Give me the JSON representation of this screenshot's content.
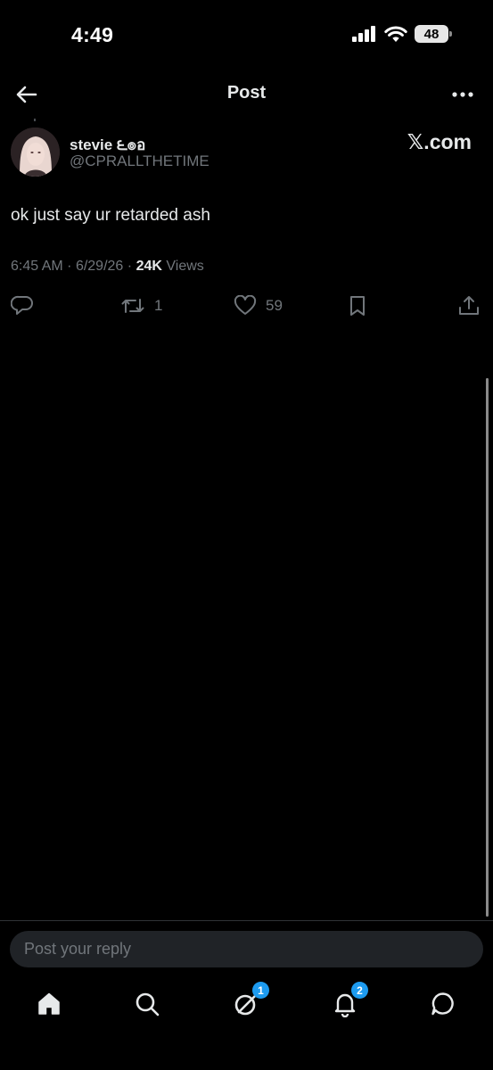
{
  "status_bar": {
    "time": "4:49",
    "battery": "48"
  },
  "header": {
    "title": "Post"
  },
  "post": {
    "author": {
      "name": "stevie ౬๏อ",
      "handle": "@CPRALLTHETIME"
    },
    "source": "𝕏.com",
    "text": "ok just say ur retarded ash",
    "meta": {
      "time": "6:45 AM",
      "date": "6/29/26",
      "views_count": "24K",
      "views_label": "Views"
    },
    "actions": {
      "reposts": "1",
      "likes": "59"
    }
  },
  "reply": {
    "placeholder": "Post your reply"
  },
  "tabs": {
    "messages_badge": "1",
    "notifications_badge": "2"
  },
  "colors": {
    "background": "#000000",
    "text": "#e7e9ea",
    "muted": "#71767b",
    "accent": "#1d9bf0",
    "input_bg": "#202327"
  },
  "icons": [
    "back-arrow-icon",
    "more-icon",
    "reply-icon",
    "repost-icon",
    "like-icon",
    "bookmark-icon",
    "share-icon",
    "home-icon",
    "search-icon",
    "grok-icon",
    "bell-icon",
    "messages-icon",
    "signal-icon",
    "wifi-icon"
  ]
}
